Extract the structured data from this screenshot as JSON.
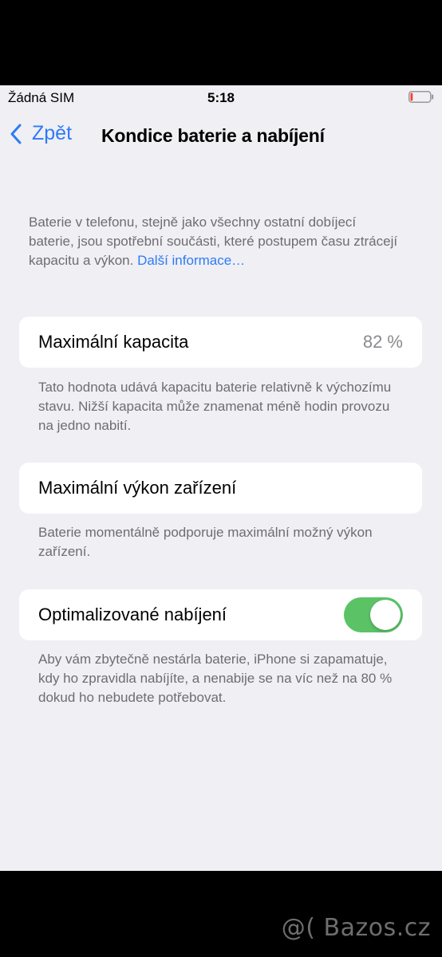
{
  "status_bar": {
    "carrier": "Žádná SIM",
    "time": "5:18",
    "battery_icon": "battery-low-icon",
    "battery_level_fraction": 0.08,
    "battery_low_color": "#ff3b30"
  },
  "nav": {
    "back_label": "Zpět",
    "back_icon": "chevron-left-icon",
    "title": "Kondice baterie a nabíjení"
  },
  "intro": {
    "text": "Baterie v telefonu, stejně jako všechny ostatní dobíjecí baterie, jsou spotřební součásti, které postupem času ztrácejí kapacitu a výkon. ",
    "link": "Další informace…"
  },
  "max_capacity": {
    "label": "Maximální kapacita",
    "value": "82 %",
    "footer": "Tato hodnota udává kapacitu baterie relativně k výchozímu stavu. Nižší kapacita může znamenat méně hodin provozu na jedno nabití."
  },
  "peak_performance": {
    "label": "Maximální výkon zařízení",
    "footer": "Baterie momentálně podporuje maximální možný výkon zařízení."
  },
  "optimized_charging": {
    "label": "Optimalizované nabíjení",
    "enabled": true,
    "toggle_color": "#5bc366",
    "footer": "Aby vám zbytečně nestárla baterie, iPhone si zapamatuje, kdy ho zpravidla nabíjíte, a nenabije se na víc než na 80 % dokud ho nebudete potřebovat."
  },
  "watermark": "@( Bazos.cz",
  "colors": {
    "accent": "#2f7bf5",
    "background": "#efeff4",
    "secondary_text": "#6d6d72"
  }
}
